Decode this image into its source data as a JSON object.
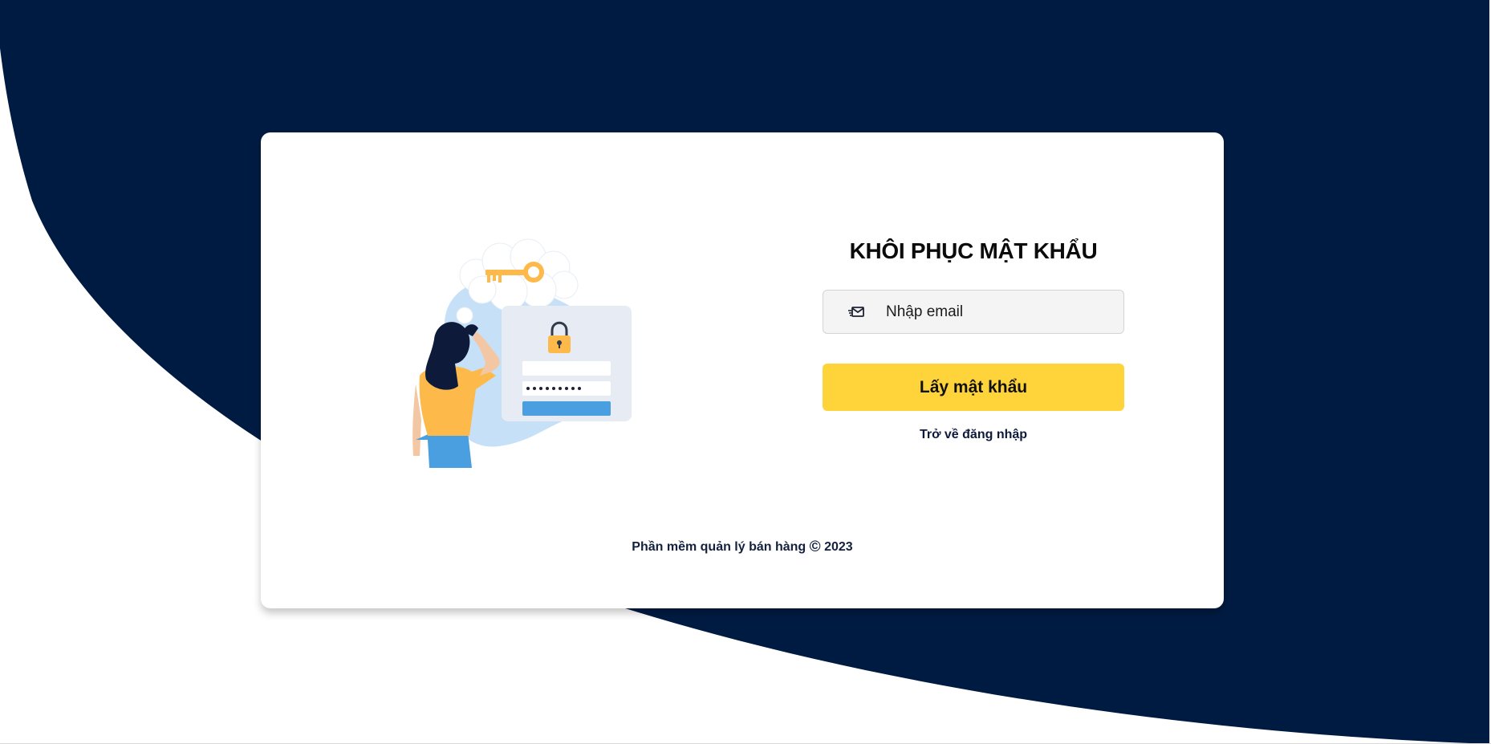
{
  "page": {
    "title": "KHÔI PHỤC MẬT KHẨU"
  },
  "form": {
    "email_placeholder": "Nhập email",
    "email_value": "",
    "submit_label": "Lấy mật khẩu",
    "back_link_label": "Trở về đăng nhập"
  },
  "footer": {
    "text": "Phần mềm quản lý bán hàng",
    "copyright_symbol": "©",
    "year": "2023"
  },
  "icons": {
    "email": "email-icon",
    "illustration": "password-recovery-illustration"
  },
  "colors": {
    "background_navy": "#001b42",
    "button_yellow": "#ffd43b",
    "illustration_blue": "#c6e0f7",
    "illustration_orange": "#fdb94a",
    "illustration_button_blue": "#4a9fe0"
  }
}
